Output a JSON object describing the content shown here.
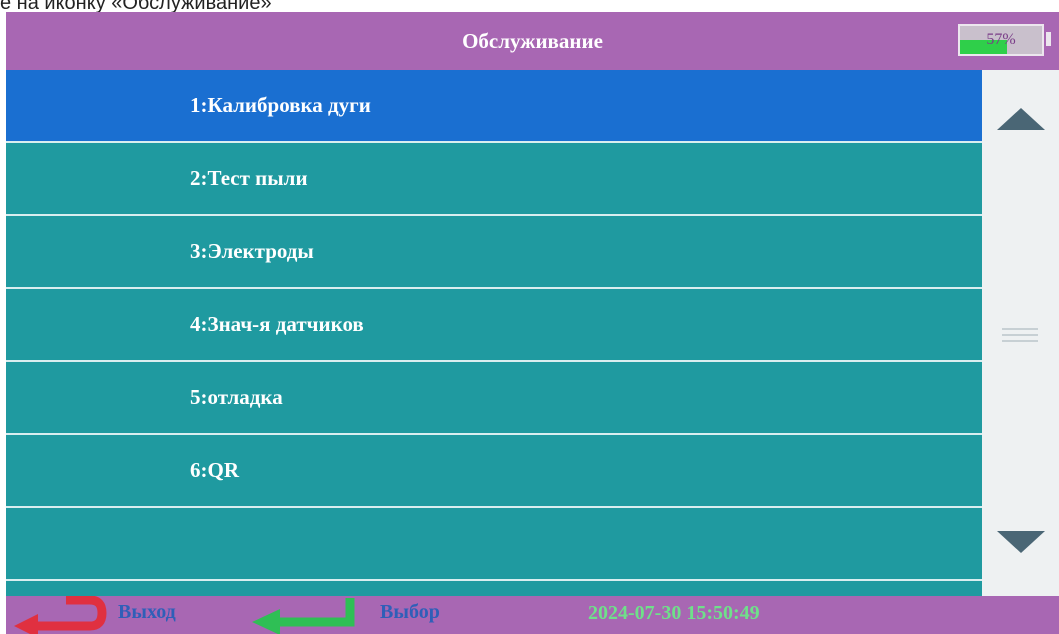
{
  "caption": "е на иконку «Обслуживание»",
  "header": {
    "title": "Обслуживание",
    "battery_text": "57%",
    "battery_level": 0.57
  },
  "menu": {
    "items": [
      {
        "label": "1:Калибровка дуги",
        "selected": true
      },
      {
        "label": "2:Тест пыли",
        "selected": false
      },
      {
        "label": "3:Электроды",
        "selected": false
      },
      {
        "label": "4:Знач-я датчиков",
        "selected": false
      },
      {
        "label": "5:отладка",
        "selected": false
      },
      {
        "label": "6:QR",
        "selected": false
      },
      {
        "label": "",
        "selected": false
      }
    ]
  },
  "scrollbar": {
    "up_icon": "triangle-up-icon",
    "down_icon": "triangle-down-icon"
  },
  "footer": {
    "exit_label": "Выход",
    "exit_icon": "return-arrow-icon",
    "select_label": "Выбор",
    "select_icon": "enter-arrow-icon",
    "datetime": "2024-07-30 15:50:49"
  },
  "colors": {
    "header_bg": "#a867b3",
    "list_bg": "#1f9aa0",
    "selected_bg": "#1a6fd1",
    "battery_fill": "#2fcf4a",
    "exit_icon": "#e03040",
    "select_icon": "#2fbf55",
    "datetime": "#6fe08a"
  }
}
